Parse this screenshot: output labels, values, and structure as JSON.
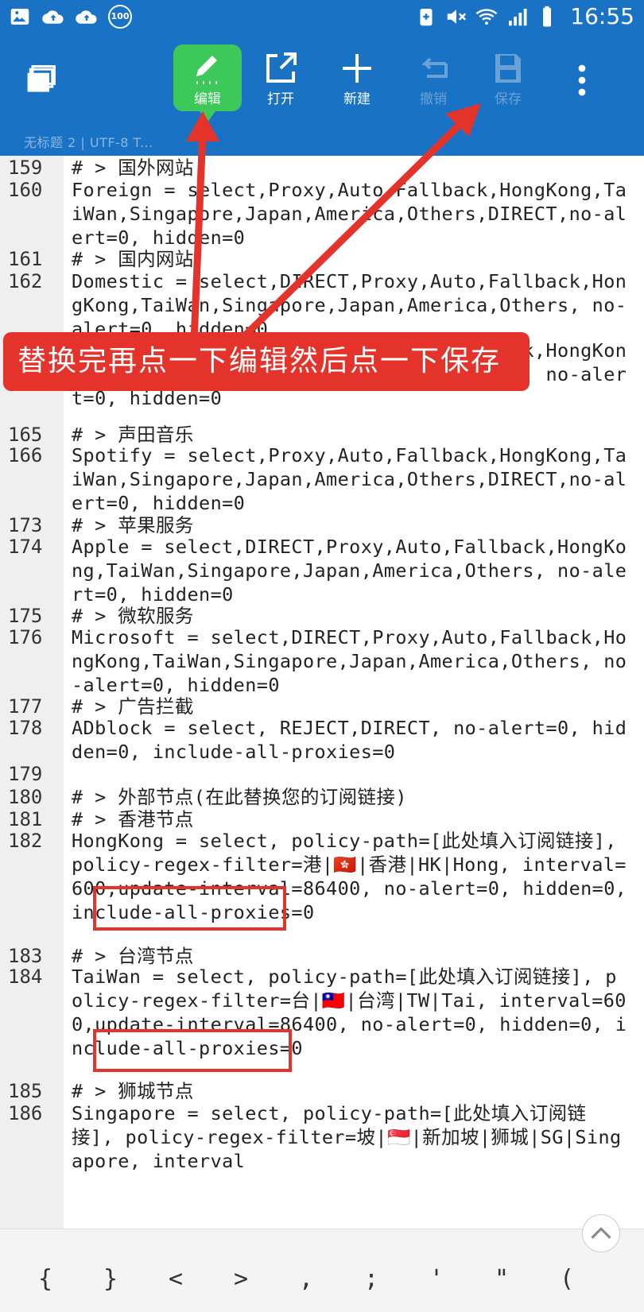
{
  "status_bar": {
    "left_icons": [
      "image-icon",
      "cloud-upload-icon",
      "cloud-upload-icon",
      "badge-100-icon"
    ],
    "badge_text": "100",
    "right_icons": [
      "battery-saver-icon",
      "mute-icon",
      "wifi-icon",
      "signal-icon",
      "battery-icon"
    ],
    "time": "16:55"
  },
  "toolbar": {
    "menu_icon": "windows-stack-icon",
    "buttons": [
      {
        "label": "编辑",
        "icon": "pencil-icon",
        "state": "active"
      },
      {
        "label": "打开",
        "icon": "open-external-icon",
        "state": "enabled"
      },
      {
        "label": "新建",
        "icon": "plus-icon",
        "state": "enabled"
      },
      {
        "label": "撤销",
        "icon": "undo-icon",
        "state": "disabled"
      },
      {
        "label": "保存",
        "icon": "save-icon",
        "state": "disabled"
      }
    ],
    "more_icon": "more-vert-icon",
    "doc_info": "无标题 2  |  UTF-8  T..."
  },
  "editor": {
    "lines": [
      {
        "num": "159",
        "text": "# > 国外网站"
      },
      {
        "num": "160",
        "text": "Foreign = select,Proxy,Auto,Fallback,HongKong,TaiWan,Singapore,Japan,America,Others,DIRECT,no-alert=0, hidden=0"
      },
      {
        "num": "161",
        "text": "# > 国内网站"
      },
      {
        "num": "162",
        "text": "Domestic = select,DIRECT,Proxy,Auto,Fallback,HongKong,TaiWan,Singapore,Japan,America,Others, no-alert=0, hidden=0"
      },
      {
        "num": "",
        "text": "                                 allback,HongKong,TaiWan,Singapore,Japan,America,Others, no-alert=0, hidden=0"
      },
      {
        "num": "165",
        "text": "# > 声田音乐"
      },
      {
        "num": "166",
        "text": "Spotify = select,Proxy,Auto,Fallback,HongKong,TaiWan,Singapore,Japan,America,Others,DIRECT,no-alert=0, hidden=0"
      },
      {
        "num": "173",
        "text": "# > 苹果服务"
      },
      {
        "num": "174",
        "text": "Apple = select,DIRECT,Proxy,Auto,Fallback,HongKong,TaiWan,Singapore,Japan,America,Others, no-alert=0, hidden=0"
      },
      {
        "num": "175",
        "text": "# > 微软服务"
      },
      {
        "num": "176",
        "text": "Microsoft = select,DIRECT,Proxy,Auto,Fallback,HongKong,TaiWan,Singapore,Japan,America,Others, no-alert=0, hidden=0"
      },
      {
        "num": "177",
        "text": "# > 广告拦截"
      },
      {
        "num": "178",
        "text": "ADblock = select, REJECT,DIRECT, no-alert=0, hidden=0, include-all-proxies=0"
      },
      {
        "num": "179",
        "text": ""
      },
      {
        "num": "180",
        "text": "# > 外部节点(在此替换您的订阅链接)"
      },
      {
        "num": "181",
        "text": "# > 香港节点"
      },
      {
        "num": "182",
        "text": "HongKong = select, policy-path=[此处填入订阅链接], policy-regex-filter=港|🇭🇰|香港|HK|Hong, interval=600,update-interval=86400, no-alert=0, hidden=0, include-all-proxies=0"
      },
      {
        "num": "183",
        "text": "# > 台湾节点"
      },
      {
        "num": "184",
        "text": "TaiWan = select, policy-path=[此处填入订阅链接], policy-regex-filter=台|🇹🇼|台湾|TW|Tai, interval=600,update-interval=86400, no-alert=0, hidden=0, include-all-proxies=0"
      },
      {
        "num": "185",
        "text": "# > 狮城节点"
      },
      {
        "num": "186",
        "text": "Singapore = select, policy-path=[此处填入订阅链接], policy-regex-filter=坡|🇸🇬|新加坡|狮城|SG|Singapore, interval"
      }
    ]
  },
  "annotation": {
    "banner_text": "替换完再点一下编辑然后点一下保存",
    "highlight_text": "此处填入订阅链接"
  },
  "symbol_bar": {
    "symbols": [
      "{",
      "}",
      "<",
      ">",
      ",",
      ";",
      "'",
      "\"",
      "("
    ],
    "scroll_up_icon": "chevron-up-icon"
  },
  "colors": {
    "toolbar_blue": "#1a72c4",
    "active_green": "#3dc85a",
    "annotation_red": "#e3332b",
    "gutter_gray": "#efefef"
  }
}
